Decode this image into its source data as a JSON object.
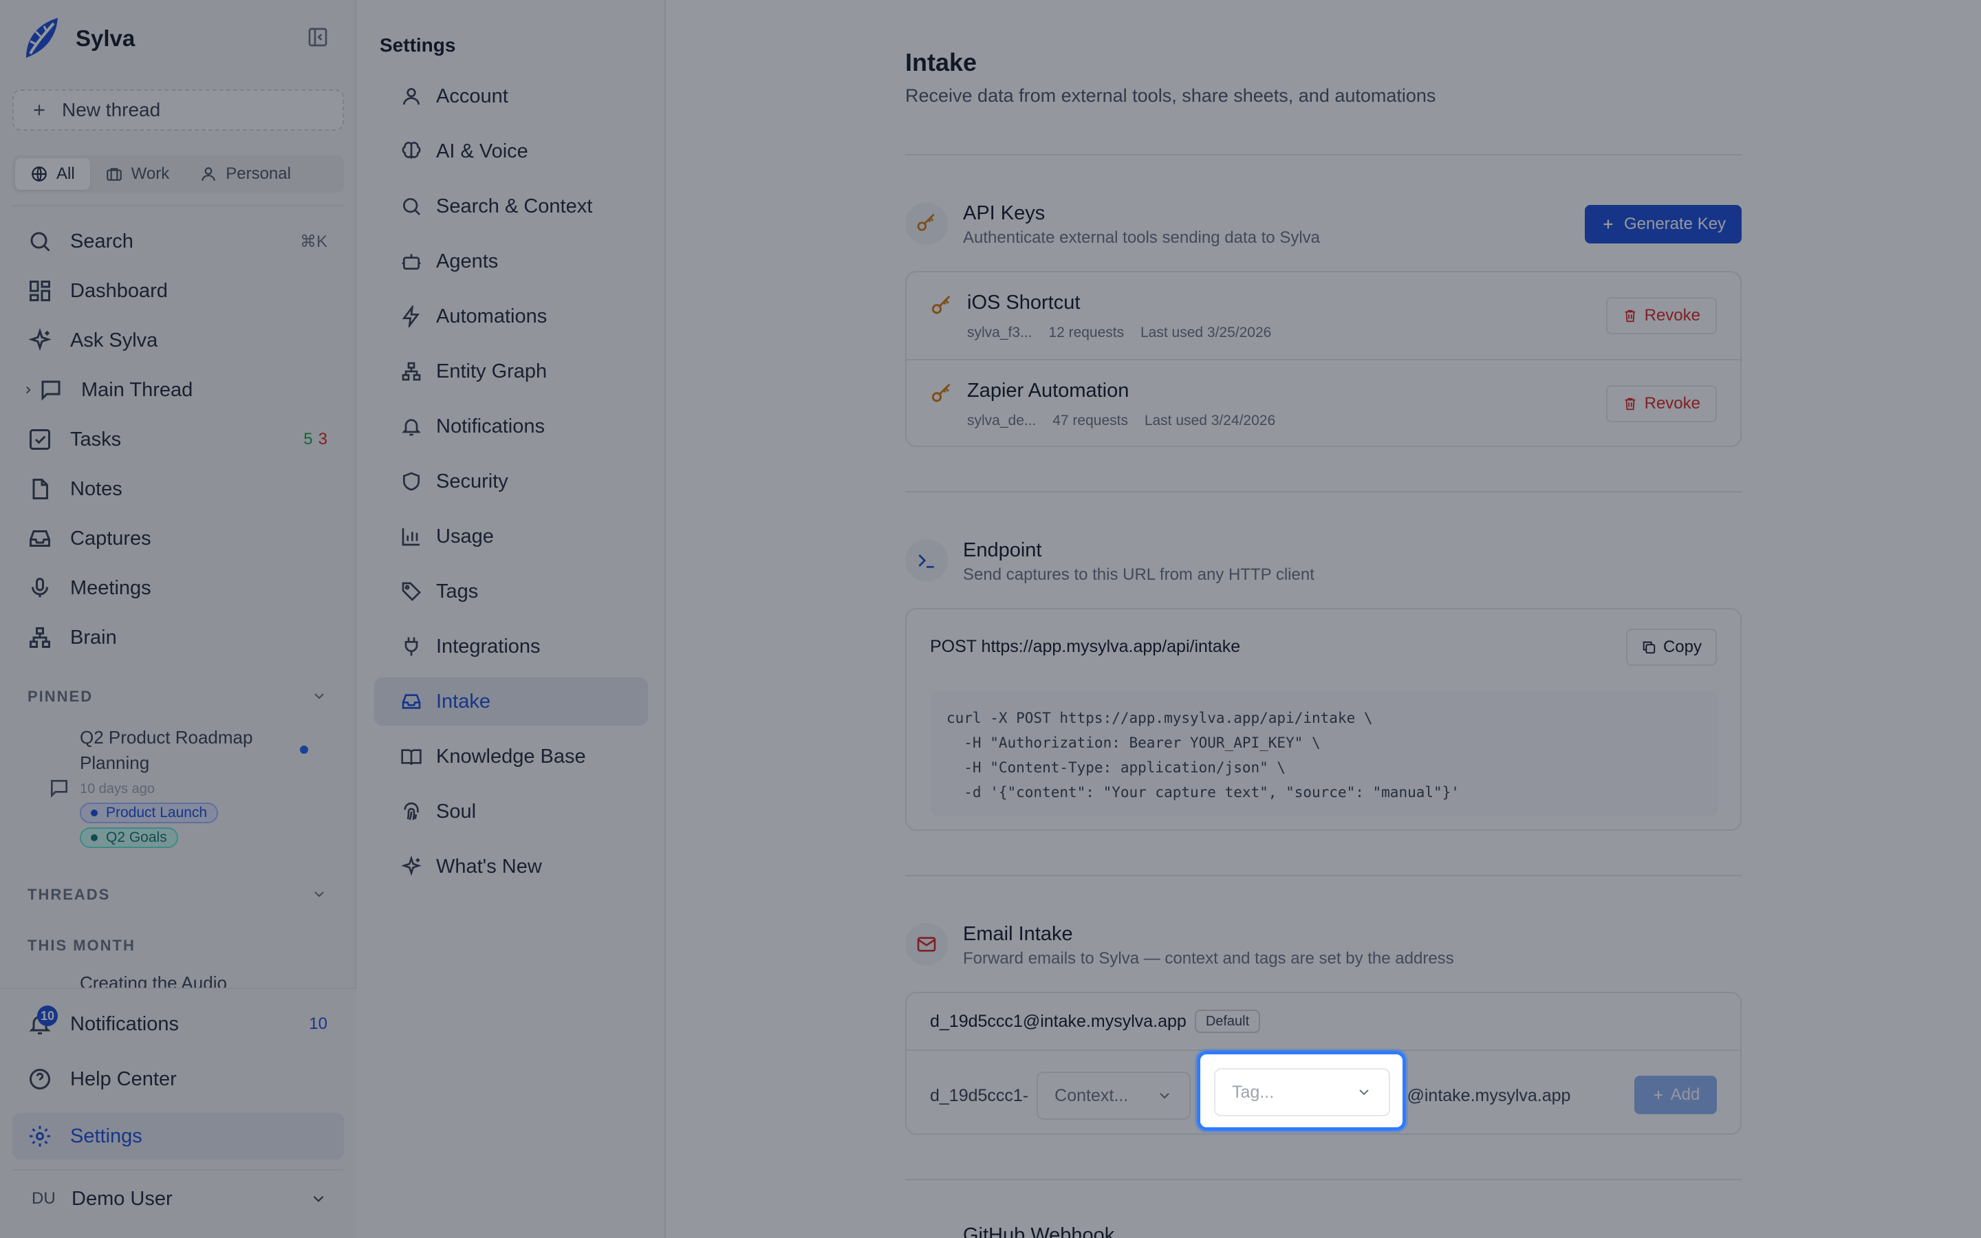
{
  "app": {
    "name": "Sylva"
  },
  "sidebar": {
    "new_thread": "New thread",
    "scopes": [
      {
        "label": "All",
        "icon": "globe-icon",
        "active": true
      },
      {
        "label": "Work",
        "icon": "briefcase-icon"
      },
      {
        "label": "Personal",
        "icon": "user-icon"
      }
    ],
    "nav": {
      "search": {
        "label": "Search",
        "shortcut": "⌘K"
      },
      "dashboard": {
        "label": "Dashboard"
      },
      "ask": {
        "label": "Ask Sylva"
      },
      "main_thread": {
        "label": "Main Thread"
      },
      "tasks": {
        "label": "Tasks",
        "count_done": "5",
        "count_overdue": "3"
      },
      "notes": {
        "label": "Notes"
      },
      "captures": {
        "label": "Captures"
      },
      "meetings": {
        "label": "Meetings"
      },
      "brain": {
        "label": "Brain"
      }
    },
    "pinned_label": "PINNED",
    "pinned": {
      "title": "Q2 Product Roadmap Planning",
      "time": "10 days ago",
      "tags": [
        "Product Launch",
        "Q2 Goals"
      ]
    },
    "threads_label": "THREADS",
    "this_month_label": "THIS MONTH",
    "truncated_thread": "Creating the Audio",
    "bottom": {
      "notifications": {
        "label": "Notifications",
        "badge": "10",
        "count": "10"
      },
      "help": {
        "label": "Help Center"
      },
      "settings": {
        "label": "Settings"
      }
    },
    "user": {
      "initials": "DU",
      "name": "Demo User"
    }
  },
  "settings_nav": {
    "title": "Settings",
    "items": [
      {
        "label": "Account",
        "icon": "user-icon"
      },
      {
        "label": "AI & Voice",
        "icon": "brain-icon"
      },
      {
        "label": "Search & Context",
        "icon": "search-icon"
      },
      {
        "label": "Agents",
        "icon": "bot-icon"
      },
      {
        "label": "Automations",
        "icon": "zap-icon"
      },
      {
        "label": "Entity Graph",
        "icon": "network-icon"
      },
      {
        "label": "Notifications",
        "icon": "bell-icon"
      },
      {
        "label": "Security",
        "icon": "shield-icon"
      },
      {
        "label": "Usage",
        "icon": "bar-chart-icon"
      },
      {
        "label": "Tags",
        "icon": "tag-icon"
      },
      {
        "label": "Integrations",
        "icon": "plug-icon"
      },
      {
        "label": "Intake",
        "icon": "inbox-icon",
        "active": true
      },
      {
        "label": "Knowledge Base",
        "icon": "book-icon"
      },
      {
        "label": "Soul",
        "icon": "fingerprint-icon"
      },
      {
        "label": "What's New",
        "icon": "sparkles-icon"
      }
    ]
  },
  "main": {
    "title": "Intake",
    "subtitle": "Receive data from external tools, share sheets, and automations",
    "api_keys": {
      "title": "API Keys",
      "desc": "Authenticate external tools sending data to Sylva",
      "generate_label": "Generate Key",
      "keys": [
        {
          "name": "iOS Shortcut",
          "prefix": "sylva_f3...",
          "requests": "12 requests",
          "last_used": "Last used 3/25/2026",
          "revoke_label": "Revoke"
        },
        {
          "name": "Zapier Automation",
          "prefix": "sylva_de...",
          "requests": "47 requests",
          "last_used": "Last used 3/24/2026",
          "revoke_label": "Revoke"
        }
      ]
    },
    "endpoint": {
      "title": "Endpoint",
      "desc": "Send captures to this URL from any HTTP client",
      "url_line": "POST https://app.mysylva.app/api/intake",
      "copy_label": "Copy",
      "code": [
        "curl -X POST https://app.mysylva.app/api/intake \\",
        "  -H \"Authorization: Bearer YOUR_API_KEY\" \\",
        "  -H \"Content-Type: application/json\" \\",
        "  -d '{\"content\": \"Your capture text\", \"source\": \"manual\"}'"
      ]
    },
    "email": {
      "title": "Email Intake",
      "desc": "Forward emails to Sylva — context and tags are set by the address",
      "default_address": "d_19d5ccc1@intake.mysylva.app",
      "default_badge": "Default",
      "prefix": "d_19d5ccc1-",
      "context_placeholder": "Context...",
      "separator": "-",
      "tag_placeholder": "Tag...",
      "suffix": "@intake.mysylva.app",
      "add_label": "Add"
    },
    "github": {
      "title": "GitHub Webhook"
    }
  },
  "colors": {
    "accent": "#1d4ed8",
    "danger": "#dc2626",
    "key": "#d97706",
    "highlight": "#2f7bff"
  }
}
